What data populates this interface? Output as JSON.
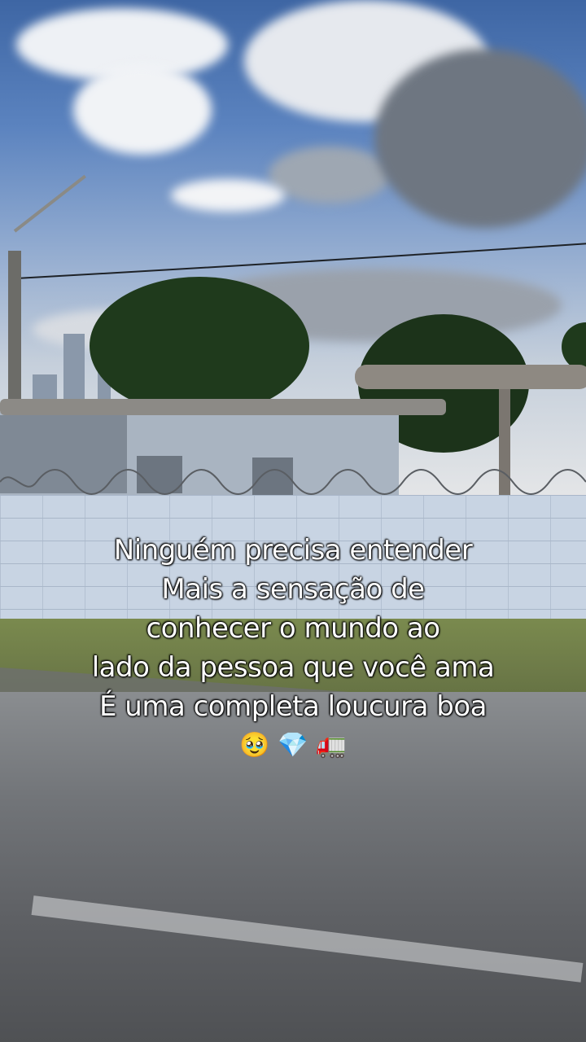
{
  "caption": {
    "lines": [
      "Ninguém precisa entender",
      "Mais a sensação de",
      "conhecer o mundo ao",
      "lado da pessoa que você ama",
      "É uma completa loucura boa"
    ],
    "emojis": [
      "🥹",
      "💎",
      "🚛"
    ]
  },
  "colors": {
    "sky_top": "#3e66a4",
    "wall": "#c8d4e3",
    "road": "#727579",
    "grass": "#6d7a48",
    "caption_text": "#ffffff"
  }
}
